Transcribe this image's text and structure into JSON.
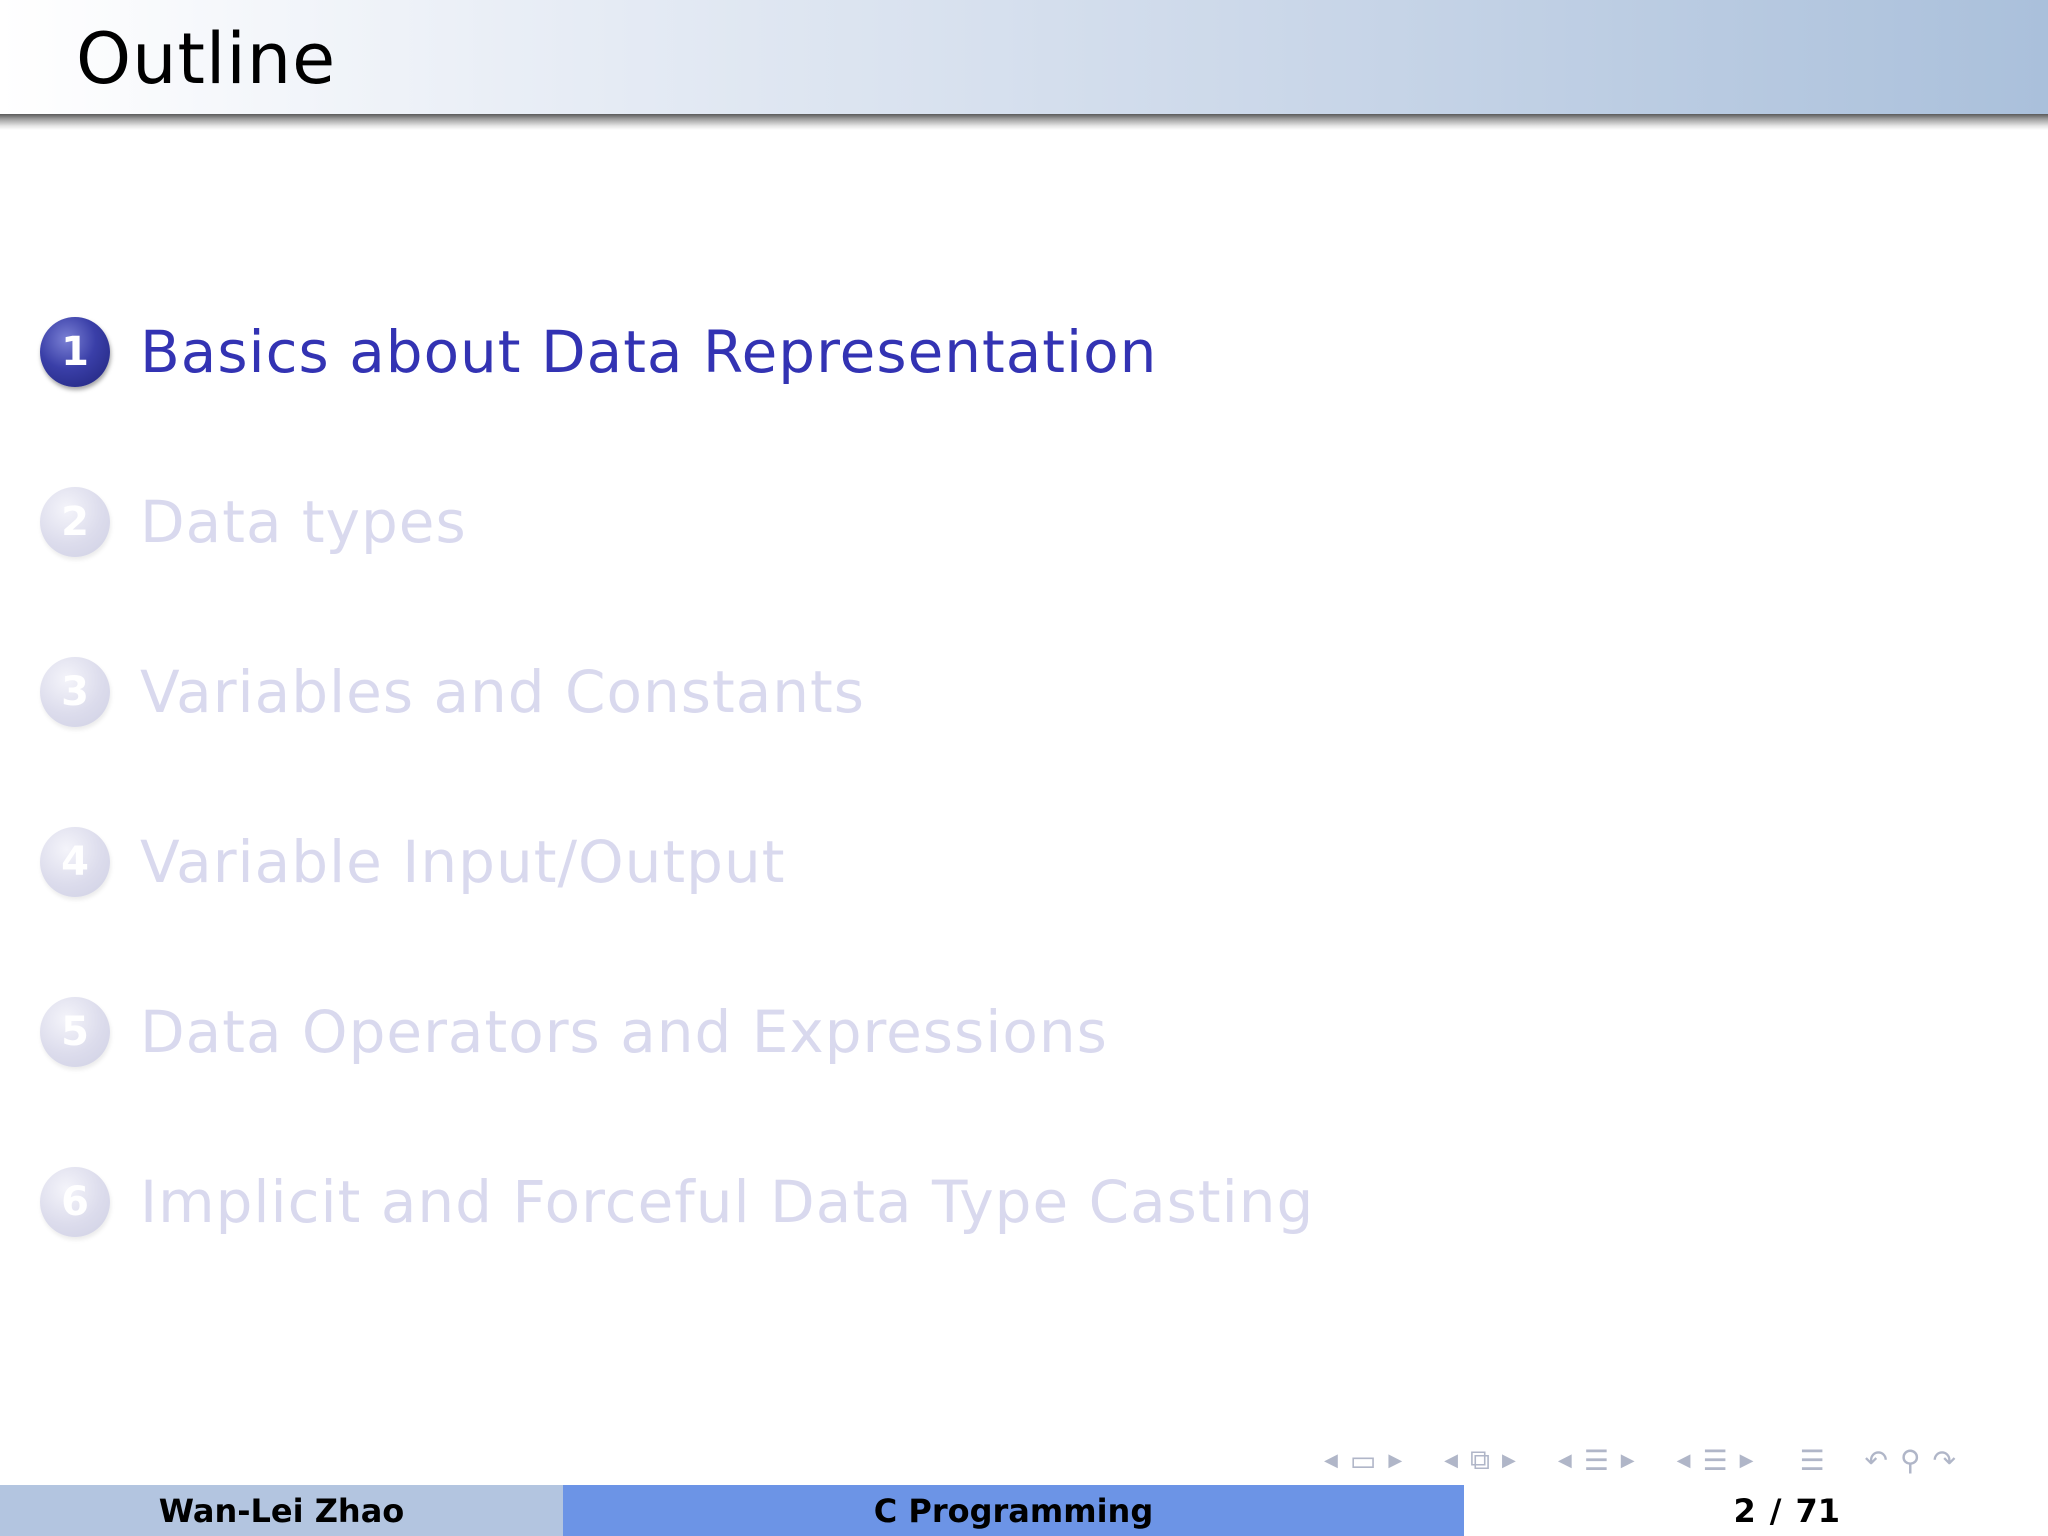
{
  "frame": {
    "title": "Outline"
  },
  "toc": {
    "items": [
      {
        "number": "1",
        "label": "Basics about Data Representation",
        "active": true
      },
      {
        "number": "2",
        "label": "Data types",
        "active": false
      },
      {
        "number": "3",
        "label": "Variables and Constants",
        "active": false
      },
      {
        "number": "4",
        "label": "Variable Input/Output",
        "active": false
      },
      {
        "number": "5",
        "label": "Data Operators and Expressions",
        "active": false
      },
      {
        "number": "6",
        "label": "Implicit and Forceful Data Type Casting",
        "active": false
      }
    ]
  },
  "navigation": {
    "icons": [
      "frame-icon",
      "subsection-icon",
      "section-icon",
      "document-icon",
      "menu-icon",
      "undo-icon",
      "search-icon",
      "redo-icon"
    ]
  },
  "footer": {
    "author": "Wan-Lei Zhao",
    "title": "C Programming",
    "page_current": "2",
    "page_separator": "/",
    "page_total": "71"
  },
  "colors": {
    "active_item": "#3333b3",
    "inactive_item": "#d9d9ee",
    "footer_author_bg": "#b3c5e0",
    "footer_title_bg": "#6c94e6"
  }
}
